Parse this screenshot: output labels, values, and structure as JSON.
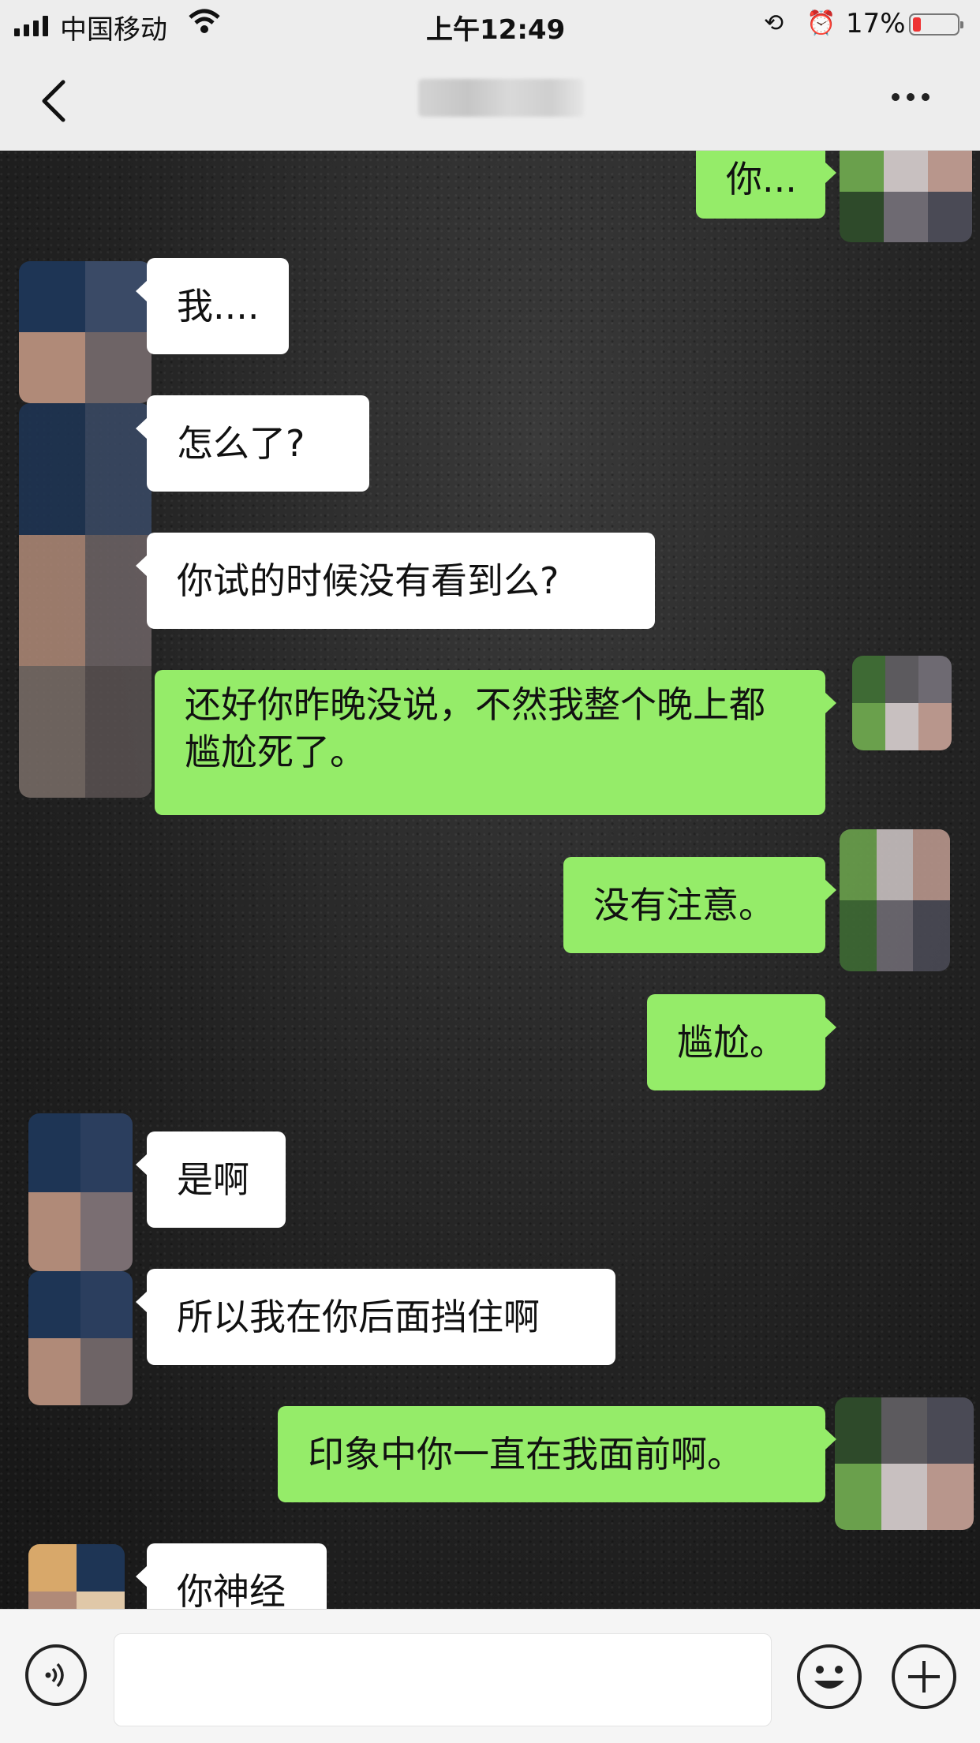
{
  "status_bar": {
    "carrier": "中国移动",
    "time": "上午12:49",
    "battery_percent": "17%",
    "battery_level": 0.17,
    "icons": [
      "signal-icon",
      "wifi-icon",
      "rotation-lock-icon",
      "alarm-icon",
      "battery-icon"
    ]
  },
  "nav_bar": {
    "icons": [
      "back-icon",
      "more-icon"
    ]
  },
  "messages": [
    {
      "side": "out",
      "text": "你..."
    },
    {
      "side": "in",
      "text": "我...."
    },
    {
      "side": "in",
      "text": "怎么了?"
    },
    {
      "side": "in",
      "text": "你试的时候没有看到么?"
    },
    {
      "side": "out",
      "text": "还好你昨晚没说，不然我整个晚上都尴尬死了。"
    },
    {
      "side": "out",
      "text": "没有注意。"
    },
    {
      "side": "out",
      "text": "尴尬。"
    },
    {
      "side": "in",
      "text": "是啊"
    },
    {
      "side": "in",
      "text": "所以我在你后面挡住啊"
    },
    {
      "side": "out",
      "text": "印象中你一直在我面前啊。"
    },
    {
      "side": "in",
      "text": "你神经"
    }
  ],
  "input_bar": {
    "input_value": "",
    "icons": [
      "voice-icon",
      "emoji-icon",
      "plus-icon"
    ]
  },
  "colors": {
    "outgoing_bubble": "#95ec69",
    "incoming_bubble": "#ffffff",
    "bar_background": "#ededed"
  }
}
